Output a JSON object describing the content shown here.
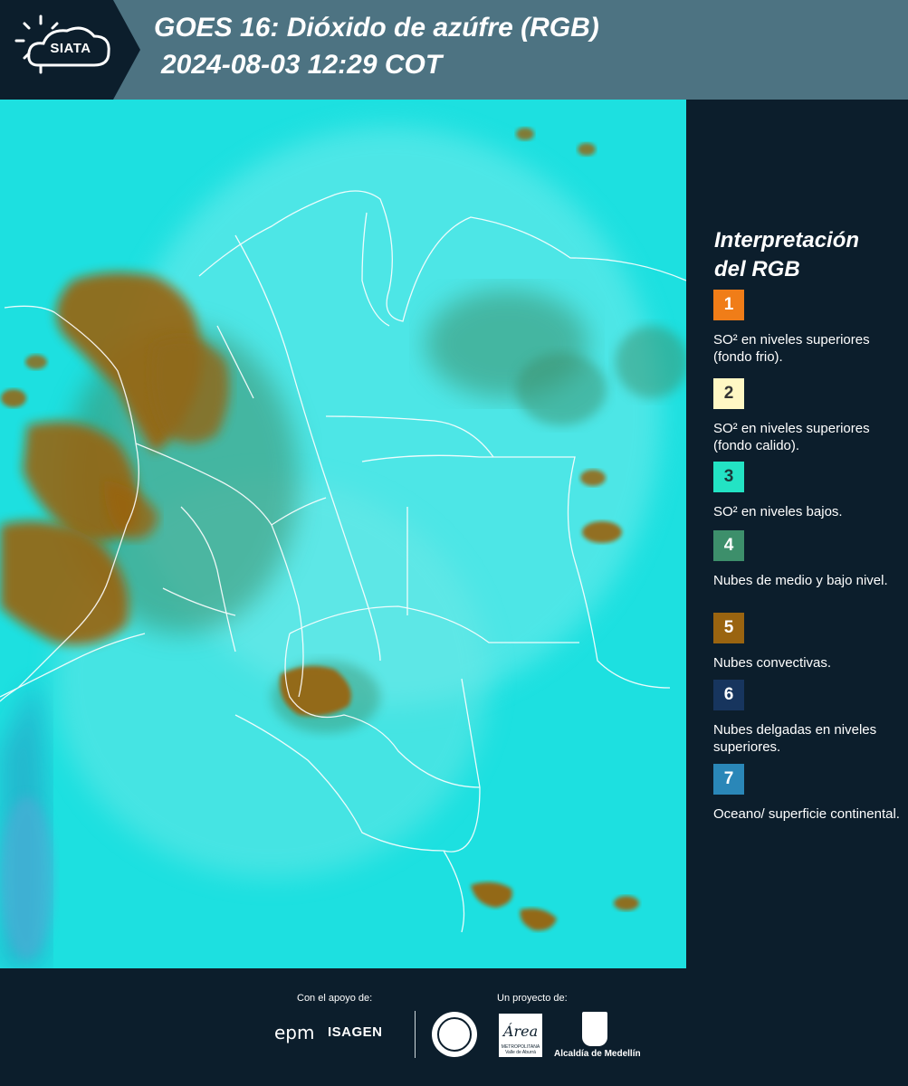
{
  "header": {
    "logo": "SIATA",
    "title_line1": "GOES 16: Dióxido de azúfre (RGB)",
    "title_line2": "2024-08-03 12:29 COT"
  },
  "legend": {
    "title": "Interpretación del RGB",
    "items": [
      {
        "number": "1",
        "color": "#f07d18",
        "text_color": "#ffffff",
        "text": "SO² en niveles superiores (fondo frio)."
      },
      {
        "number": "2",
        "color": "#fff7c4",
        "text_color": "#333333",
        "text": "SO² en niveles superiores (fondo calido)."
      },
      {
        "number": "3",
        "color": "#23e3c4",
        "text_color": "#1a3a3a",
        "text": "SO² en niveles bajos."
      },
      {
        "number": "4",
        "color": "#3d8f6b",
        "text_color": "#ffffff",
        "text": "Nubes de medio y bajo nivel."
      },
      {
        "number": "5",
        "color": "#9a6410",
        "text_color": "#ffffff",
        "text": "Nubes convectivas."
      },
      {
        "number": "6",
        "color": "#17355e",
        "text_color": "#ffffff",
        "text": "Nubes delgadas en niveles superiores."
      },
      {
        "number": "7",
        "color": "#2a87b8",
        "text_color": "#ffffff",
        "text": "Oceano/ superficie continental."
      }
    ]
  },
  "footer": {
    "support_label": "Con el apoyo de:",
    "project_label": "Un proyecto de:",
    "sponsor_epm": "epm",
    "sponsor_isagen": "ISAGEN",
    "area_logo_text": "Área",
    "area_logo_sub": "METROPOLITANA Valle de Aburrá",
    "alcaldia": "Alcaldía de Medellín"
  },
  "colors": {
    "header_bg": "#4d7382",
    "panel_bg": "#0c1e2c",
    "map_cyan": "#1de0e0",
    "convective_brown": "#9a6410"
  }
}
